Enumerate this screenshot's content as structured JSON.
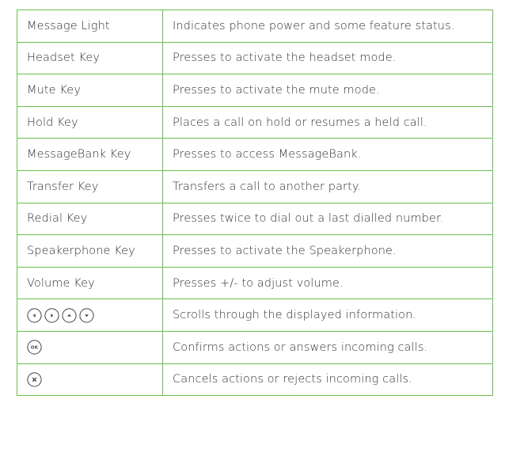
{
  "rows": [
    {
      "key": "Message Light",
      "description": "Indicates phone power and some feature status."
    },
    {
      "key": "Headset Key",
      "description": "Presses to activate the headset mode."
    },
    {
      "key": "Mute Key",
      "description": "Presses to activate the mute mode."
    },
    {
      "key": "Hold Key",
      "description": "Places a call on hold or resumes a held call."
    },
    {
      "key": "MessageBank Key",
      "description": "Presses to access MessageBank."
    },
    {
      "key": "Transfer Key",
      "description": "Transfers a call to another party."
    },
    {
      "key": "Redial Key",
      "description": "Presses twice to dial out a last dialled number."
    },
    {
      "key": "Speakerphone Key",
      "description": "Presses to activate the Speakerphone."
    },
    {
      "key": "Volume Key",
      "description": "Presses +/- to adjust volume."
    },
    {
      "key_icons": [
        "left-arrow-icon",
        "right-arrow-icon",
        "up-arrow-icon",
        "down-arrow-icon"
      ],
      "description": "Scrolls through the displayed information."
    },
    {
      "key_icons": [
        "ok-icon"
      ],
      "ok_label": "OK",
      "description": "Confirms actions or answers incoming calls."
    },
    {
      "key_icons": [
        "cancel-x-icon"
      ],
      "description": "Cancels actions or rejects incoming calls."
    }
  ],
  "colors": {
    "border": "#6abf4b",
    "text": "#333333"
  }
}
